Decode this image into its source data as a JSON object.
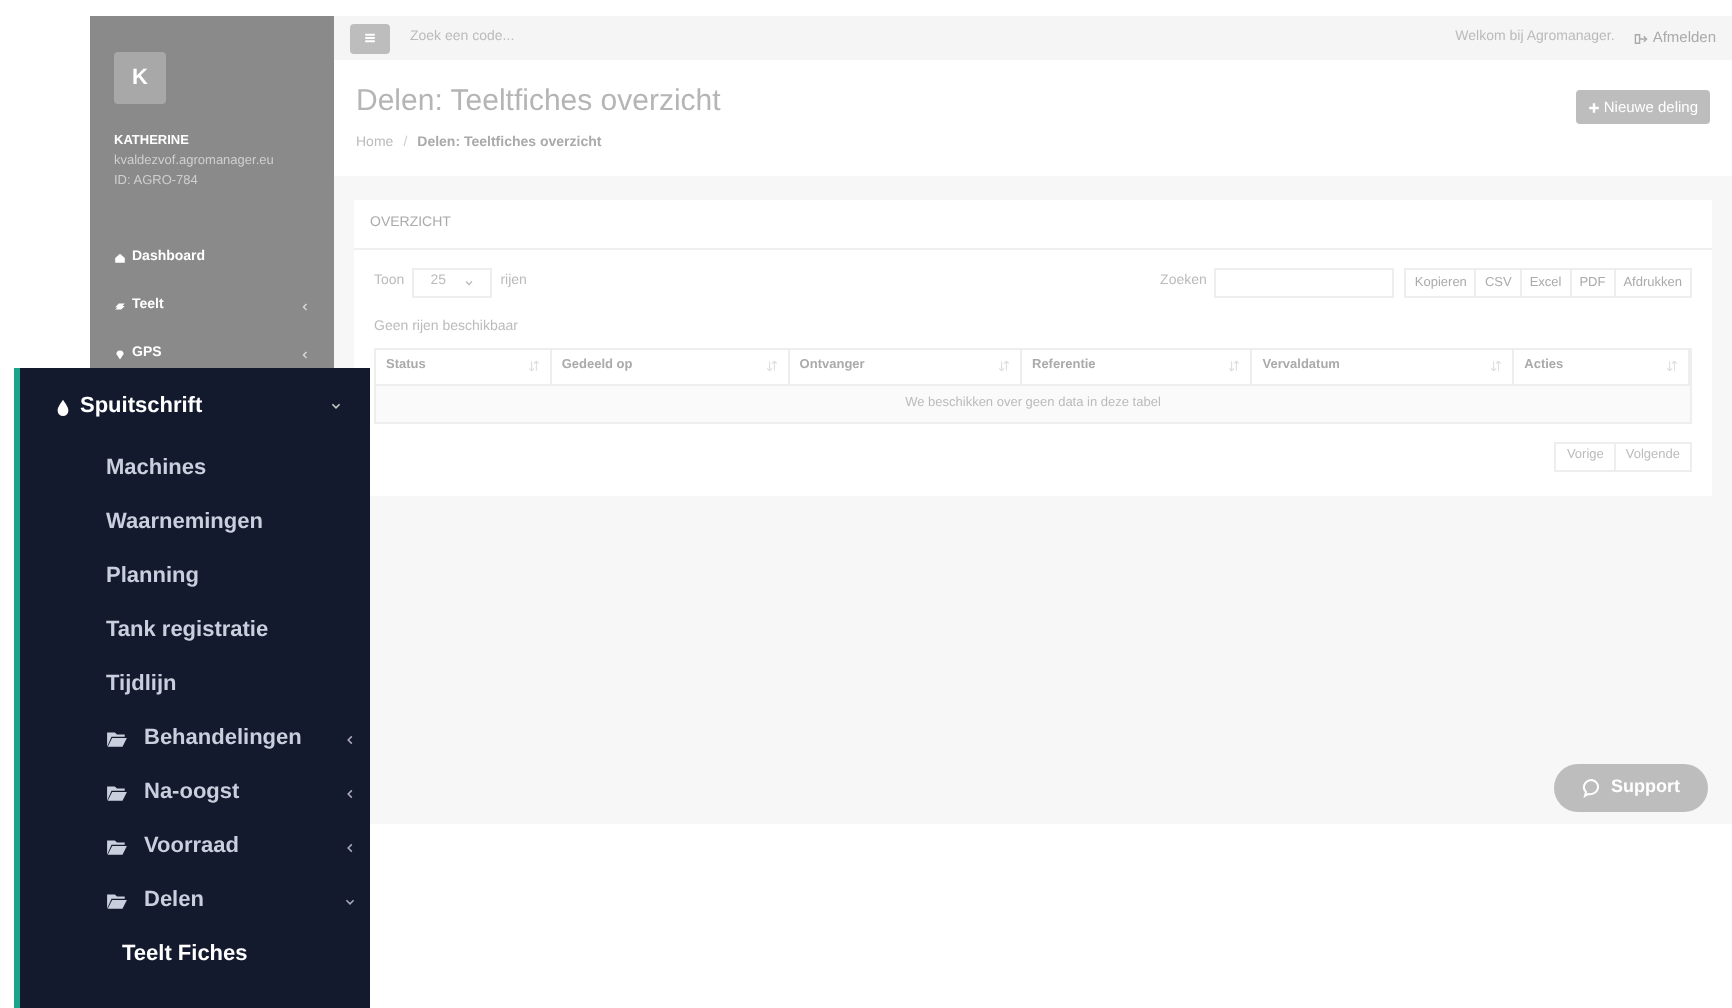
{
  "sidebar": {
    "avatar_letter": "K",
    "user_name": "KATHERINE",
    "email": "kvaldezvof.agromanager.eu",
    "user_id": "ID: AGRO-784",
    "items": [
      {
        "kind": "home",
        "label": "Dashboard",
        "has_submenu": false
      },
      {
        "kind": "layers",
        "label": "Teelt",
        "has_submenu": true
      },
      {
        "kind": "pin",
        "label": "GPS",
        "has_submenu": true
      }
    ]
  },
  "topbar": {
    "search_placeholder": "Zoek een code...",
    "welcome": "Welkom bij Agromanager.",
    "logout": "Afmelden"
  },
  "header": {
    "title": "Delen: Teeltfiches overzicht",
    "breadcrumb": [
      "Home",
      "Delen: Teeltfiches overzicht"
    ],
    "breadcrumb_separator": "/",
    "new_button": "Nieuwe deling"
  },
  "panel": {
    "title": "OVERZICHT",
    "show_label": "Toon",
    "page_size": "25",
    "rows_label": "rijen",
    "search_label": "Zoeken",
    "export_buttons": [
      "Kopieren",
      "CSV",
      "Excel",
      "PDF",
      "Afdrukken"
    ],
    "info": "Geen rijen beschikbaar",
    "columns": [
      "Status",
      "Gedeeld op",
      "Ontvanger",
      "Referentie",
      "Vervaldatum",
      "Acties"
    ],
    "empty_message": "We beschikken over geen data in deze tabel",
    "pagination": [
      "Vorige",
      "Volgende"
    ]
  },
  "support_button": "Support",
  "zoomed_menu": {
    "label": "Spuitschrift",
    "expanded": true,
    "items": [
      {
        "kind": "link",
        "label": "Machines"
      },
      {
        "kind": "link",
        "label": "Waarnemingen"
      },
      {
        "kind": "link",
        "label": "Planning"
      },
      {
        "kind": "link",
        "label": "Tank registratie"
      },
      {
        "kind": "link",
        "label": "Tijdlijn"
      },
      {
        "kind": "folder",
        "label": "Behandelingen",
        "expanded": false
      },
      {
        "kind": "folder",
        "label": "Na-oogst",
        "expanded": false
      },
      {
        "kind": "folder",
        "label": "Voorraad",
        "expanded": false
      },
      {
        "kind": "folder",
        "label": "Delen",
        "expanded": true,
        "children": [
          {
            "label": "Teelt Fiches"
          }
        ]
      }
    ]
  }
}
